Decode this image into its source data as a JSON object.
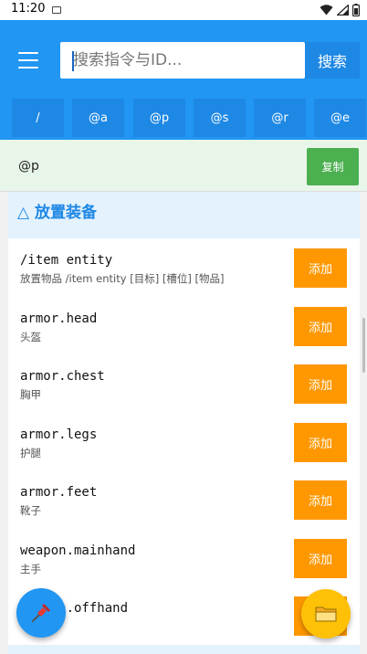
{
  "status_bar": {
    "time": "11:20"
  },
  "search": {
    "placeholder": "搜索指令与ID...",
    "value": "",
    "button_label": "搜索"
  },
  "selectors": [
    {
      "label": "/"
    },
    {
      "label": "@a"
    },
    {
      "label": "@p"
    },
    {
      "label": "@s"
    },
    {
      "label": "@r"
    },
    {
      "label": "@e"
    }
  ],
  "command_output": {
    "text": "@p",
    "copy_label": "复制"
  },
  "section": {
    "title": "△ 放置装备"
  },
  "items": [
    {
      "code": "/item entity",
      "desc": "放置物品 /item entity [目标] [槽位] [物品]",
      "add_label": "添加"
    },
    {
      "code": "armor.head",
      "desc": "头盔",
      "add_label": "添加"
    },
    {
      "code": "armor.chest",
      "desc": "胸甲",
      "add_label": "添加"
    },
    {
      "code": "armor.legs",
      "desc": "护腿",
      "add_label": "添加"
    },
    {
      "code": "armor.feet",
      "desc": "靴子",
      "add_label": "添加"
    },
    {
      "code": "weapon.mainhand",
      "desc": "主手",
      "add_label": "添加"
    },
    {
      "code": "weapon.offhand",
      "desc": "",
      "add_label": ""
    }
  ],
  "fabs": {
    "left_icon": "pin-icon",
    "right_icon": "folder-icon"
  },
  "colors": {
    "primary": "#2196F3",
    "copy": "#4CAF50",
    "add": "#FF9800",
    "fab_right": "#FFC107"
  }
}
